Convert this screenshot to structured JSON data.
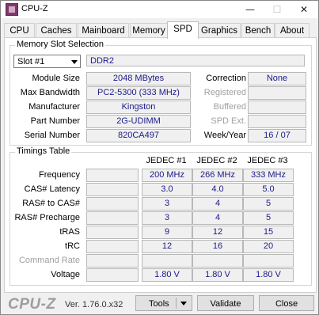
{
  "window": {
    "title": "CPU-Z"
  },
  "tabs": [
    {
      "label": "CPU"
    },
    {
      "label": "Caches"
    },
    {
      "label": "Mainboard"
    },
    {
      "label": "Memory"
    },
    {
      "label": "SPD"
    },
    {
      "label": "Graphics"
    },
    {
      "label": "Bench"
    },
    {
      "label": "About"
    }
  ],
  "active_tab": "SPD",
  "slot": {
    "group_title": "Memory Slot Selection",
    "selected": "Slot #1",
    "type": "DDR2",
    "module_size_label": "Module Size",
    "module_size": "2048 MBytes",
    "max_bw_label": "Max Bandwidth",
    "max_bw": "PC2-5300 (333 MHz)",
    "manufacturer_label": "Manufacturer",
    "manufacturer": "Kingston",
    "part_label": "Part Number",
    "part": "2G-UDIMM",
    "serial_label": "Serial Number",
    "serial": "820CA497",
    "correction_label": "Correction",
    "correction": "None",
    "registered_label": "Registered",
    "registered": "",
    "buffered_label": "Buffered",
    "buffered": "",
    "spd_ext_label": "SPD Ext.",
    "spd_ext": "",
    "week_year_label": "Week/Year",
    "week_year": "16 / 07"
  },
  "timings": {
    "group_title": "Timings Table",
    "columns": [
      "JEDEC #1",
      "JEDEC #2",
      "JEDEC #3"
    ],
    "rows": [
      {
        "label": "Frequency",
        "values": [
          "200 MHz",
          "266 MHz",
          "333 MHz"
        ]
      },
      {
        "label": "CAS# Latency",
        "values": [
          "3.0",
          "4.0",
          "5.0"
        ]
      },
      {
        "label": "RAS# to CAS#",
        "values": [
          "3",
          "4",
          "5"
        ]
      },
      {
        "label": "RAS# Precharge",
        "values": [
          "3",
          "4",
          "5"
        ]
      },
      {
        "label": "tRAS",
        "values": [
          "9",
          "12",
          "15"
        ]
      },
      {
        "label": "tRC",
        "values": [
          "12",
          "16",
          "20"
        ]
      },
      {
        "label": "Command Rate",
        "values": [
          "",
          "",
          ""
        ]
      },
      {
        "label": "Voltage",
        "values": [
          "1.80 V",
          "1.80 V",
          "1.80 V"
        ]
      }
    ]
  },
  "footer": {
    "brand": "CPU-Z",
    "version": "Ver. 1.76.0.x32",
    "tools_label": "Tools",
    "validate_label": "Validate",
    "close_label": "Close"
  },
  "icons": {
    "app": "cpu-z-app-icon",
    "minimize": "minimize-icon",
    "maximize": "maximize-icon",
    "close": "close-icon"
  }
}
